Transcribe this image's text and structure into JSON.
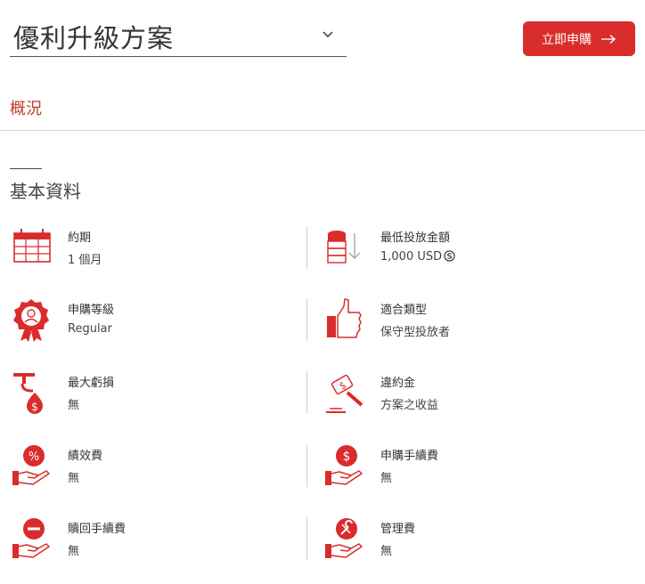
{
  "header": {
    "plan_title": "優利升級方案",
    "apply_label": "立即申購"
  },
  "tabs": {
    "overview": "概況"
  },
  "section": {
    "title": "基本資料"
  },
  "items": [
    {
      "label": "約期",
      "value": "1 個月",
      "icon": "calendar-icon"
    },
    {
      "label": "最低投放金額",
      "value": "1,000 USD",
      "icon": "coin-stack-icon"
    },
    {
      "label": "申購等級",
      "value": "Regular",
      "icon": "award-badge-icon"
    },
    {
      "label": "適合類型",
      "value": "保守型投放者",
      "icon": "thumbs-up-icon"
    },
    {
      "label": "最大虧損",
      "value": "無",
      "icon": "money-leak-icon"
    },
    {
      "label": "違約金",
      "value": "方案之收益",
      "icon": "gavel-icon"
    },
    {
      "label": "績效費",
      "value": "無",
      "icon": "percent-hand-icon"
    },
    {
      "label": "申購手續費",
      "value": "無",
      "icon": "dollar-hand-icon"
    },
    {
      "label": "贖回手續費",
      "value": "無",
      "icon": "minus-hand-icon"
    },
    {
      "label": "管理費",
      "value": "無",
      "icon": "wrench-hand-icon"
    }
  ],
  "colors": {
    "accent": "#d92c2c",
    "tab": "#c0392b"
  }
}
